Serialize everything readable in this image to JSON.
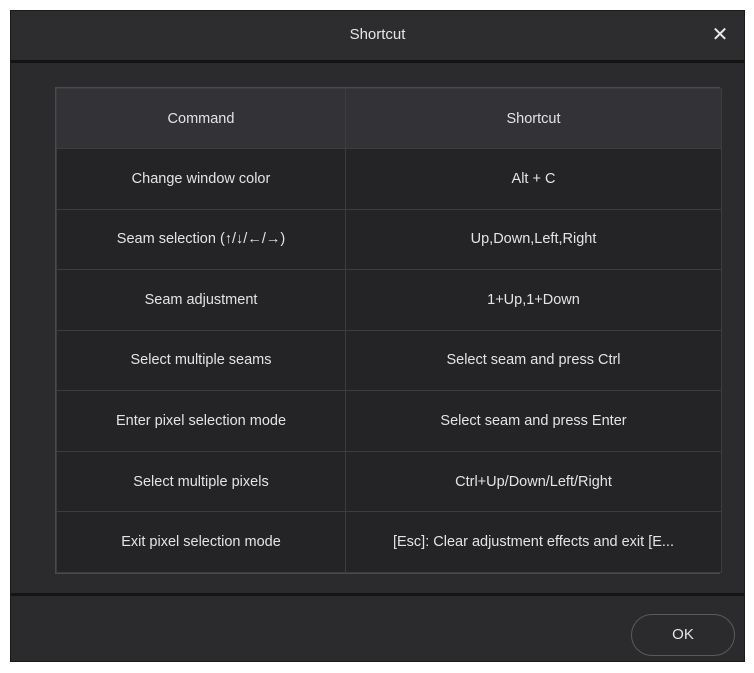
{
  "dialog": {
    "title": "Shortcut",
    "close_symbol": "✕",
    "ok_label": "OK"
  },
  "table": {
    "headers": [
      "Command",
      "Shortcut"
    ],
    "rows": [
      [
        "Change window color",
        "Alt + C"
      ],
      [
        "Seam selection (↑/↓/←/→)",
        "Up,Down,Left,Right"
      ],
      [
        "Seam adjustment",
        "1+Up,1+Down"
      ],
      [
        "Select multiple seams",
        "Select seam and press Ctrl"
      ],
      [
        "Enter pixel selection mode",
        "Select seam and press Enter"
      ],
      [
        "Select multiple pixels",
        "Ctrl+Up/Down/Left/Right"
      ],
      [
        "Exit pixel selection mode",
        "[Esc]: Clear adjustment effects and exit [E..."
      ]
    ]
  }
}
